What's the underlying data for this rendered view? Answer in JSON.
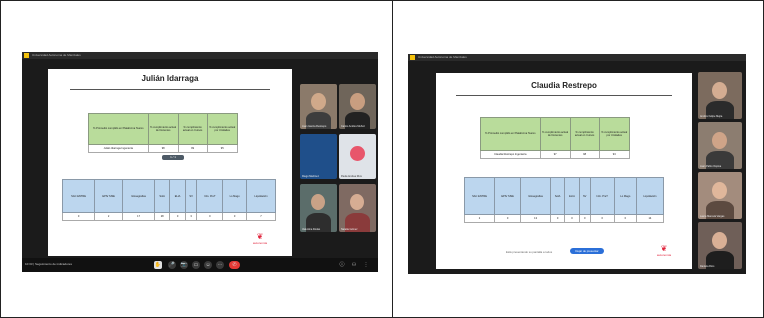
{
  "left": {
    "window_title": "Universidad Autónoma de Manizales",
    "slide_title": "Julián Idarraga",
    "table1": {
      "headers": [
        "% Promedio cumplido en Plataforma Teams",
        "% cumplimiento actual de Docentes",
        "% cumplimiento actual en Cursos",
        "% cumplimiento actual por Unidades"
      ],
      "values": [
        "Julián Idarraga Ingeniería",
        "98",
        "99",
        "95"
      ]
    },
    "pager": "1 / 1",
    "table2": {
      "headers": [
        "SAC ENTRE",
        "EPS/ SISE",
        "Glosagrafías",
        "SolA",
        "ELIA",
        "SV",
        "Info. PreT",
        "Lo Mago",
        "Liquidación"
      ],
      "values": [
        "0",
        "2",
        "17",
        "28",
        "0",
        "3",
        "0",
        "0",
        "7"
      ]
    },
    "logo_text": "autonomía",
    "participants": [
      {
        "name": "Juan Garcia Restrepo",
        "bg": "#8b7a6a"
      },
      {
        "name": "Carlos Andrés Muñoz",
        "bg": "#6f655a"
      },
      {
        "name": "Diego Martínez",
        "bg": "#1f4f8a"
      },
      {
        "name": "Paula Andrea Ríos",
        "bg": "#dfe3e8"
      },
      {
        "name": "Valentina Rodas",
        "bg": "#5b6d6a"
      },
      {
        "name": "Natalia Gómez",
        "bg": "#7f6a62"
      }
    ],
    "bar_meta": "10:33 | Seguimiento de indicadores",
    "controls": [
      "✋",
      "🎤",
      "📷",
      "▭",
      "☺",
      "⋯",
      "✆"
    ]
  },
  "right": {
    "window_title": "Universidad Autónoma de Manizales",
    "slide_title": "Claudia Restrepo",
    "table1": {
      "headers": [
        "% Promedio cumplido en Plataforma Teams",
        "% cumplimiento actual de Docentes",
        "% cumplimiento actual en Cursos",
        "% cumplimiento actual por Unidades"
      ],
      "values": [
        "Claudia Restrepo Ingeniería",
        "97",
        "98",
        "93"
      ]
    },
    "table2": {
      "headers": [
        "SAC ENTRE",
        "EPS/ SISE",
        "Glosagrafías",
        "SolA",
        "ELIA",
        "SV",
        "Info. PreT",
        "Lo Mago",
        "Liquidación"
      ],
      "values": [
        "2",
        "0",
        "13",
        "0",
        "0",
        "0",
        "0",
        "0",
        "14"
      ]
    },
    "logo_text": "autonomía",
    "share_note": "Está presentando su pantalla a todos",
    "share_button": "Dejar de presentar",
    "participants": [
      {
        "name": "Andrés Felipe Mejía",
        "bg": "#7c6b5e"
      },
      {
        "name": "Juan Pablo Ospina",
        "bg": "#8c7d70"
      },
      {
        "name": "Laura Marcela Vargas",
        "bg": "#a38c7d"
      },
      {
        "name": "Daniela Ríos",
        "bg": "#6f5f58"
      }
    ]
  }
}
